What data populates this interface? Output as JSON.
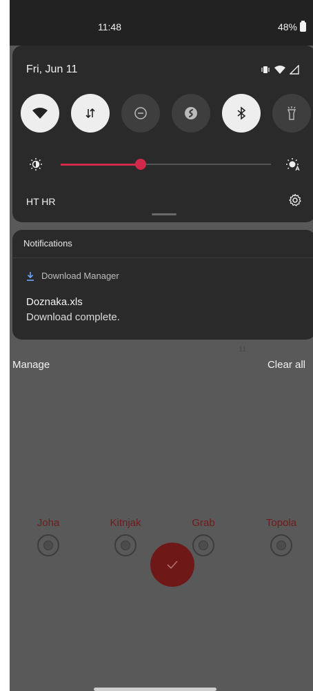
{
  "status_bar": {
    "time": "11:48",
    "battery": "48%"
  },
  "quick_settings": {
    "date": "Fri, Jun 11",
    "tiles": [
      {
        "name": "wifi",
        "active": true
      },
      {
        "name": "mobile-data",
        "active": true
      },
      {
        "name": "do-not-disturb",
        "active": false
      },
      {
        "name": "shazam",
        "active": false
      },
      {
        "name": "bluetooth",
        "active": true
      },
      {
        "name": "flashlight",
        "active": false
      }
    ],
    "brightness_level": 0.38,
    "carrier": "HT HR"
  },
  "notifications": {
    "header": "Notifications",
    "items": [
      {
        "app": "Download Manager",
        "title": "Doznaka.xls",
        "text": "Download complete."
      }
    ]
  },
  "actions": {
    "manage": "Manage",
    "clear_all": "Clear all"
  },
  "background_app": {
    "number": "11",
    "choices": [
      "Joha",
      "Kitnjak",
      "Grab",
      "Topola"
    ]
  },
  "colors": {
    "accent": "#d2294a",
    "app_brand": "#6f1818"
  }
}
